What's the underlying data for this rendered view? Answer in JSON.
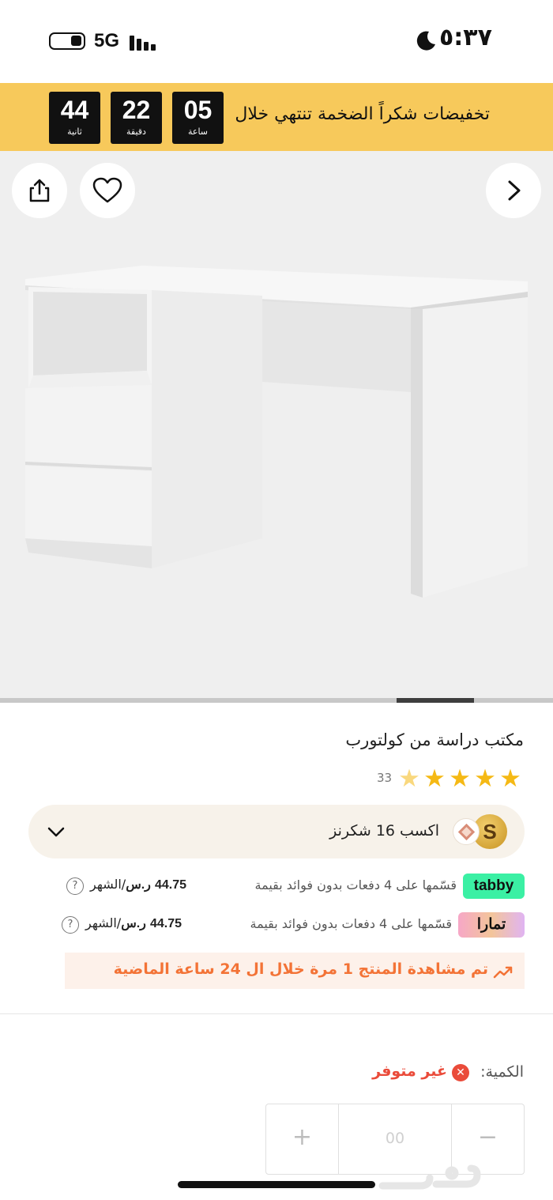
{
  "status_bar": {
    "network": "5G",
    "time": "٥:٣٧"
  },
  "promo": {
    "text": "تخفيضات شكراً الضخمة تنتهي خلال",
    "timer": [
      {
        "value": "05",
        "unit": "ساعة"
      },
      {
        "value": "22",
        "unit": "دقيقة"
      },
      {
        "value": "44",
        "unit": "ثانية"
      }
    ]
  },
  "gallery": {
    "progress_fraction": 0.14
  },
  "product": {
    "title": "مكتب دراسة من كولتورب",
    "rating": 4.5,
    "stars": [
      "★",
      "★",
      "★",
      "★",
      "★"
    ],
    "review_count": "33"
  },
  "shukranz": {
    "coin_letter": "S",
    "text": "اكسب 16 شكرنز"
  },
  "payments": {
    "tabby": {
      "logo": "tabby",
      "text": "قسّمها على 4 دفعات بدون فوائد بقيمة",
      "amount": "44.75",
      "currency": "ر.س",
      "per": "/الشهر"
    },
    "tamara": {
      "logo": "تمارا",
      "text": "قسّمها على 4 دفعات بدون فوائد بقيمة",
      "amount": "44.75",
      "currency": "ر.س",
      "per": "/الشهر"
    },
    "help": "?"
  },
  "views_banner": {
    "text": "تم مشاهدة المنتج 1 مرة خلال ال 24 ساعة الماضية"
  },
  "quantity": {
    "label": "الكمية:",
    "status": "غير متوفر",
    "value": "00",
    "plus": "+",
    "minus": "−"
  },
  "colors": {
    "promo_bg": "#f7c95b",
    "star": "#f5b915",
    "views_text": "#f37336",
    "out_of_stock": "#ea4b3a",
    "tabby": "#3bf0a4"
  },
  "icons": [
    "battery-icon",
    "signal-icon",
    "moon-icon",
    "share-icon",
    "heart-icon",
    "chevron-right-icon",
    "chevron-down-icon",
    "diamond-icon",
    "trend-up-icon",
    "x-circle-icon",
    "help-icon"
  ]
}
